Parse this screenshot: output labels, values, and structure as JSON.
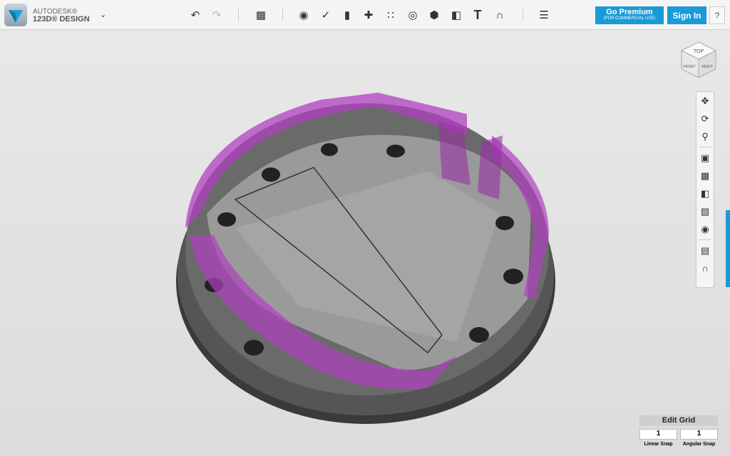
{
  "app": {
    "brand_line1": "AUTODESK®",
    "brand_line2": "123D® DESIGN"
  },
  "toolbar": {
    "undo": "undo-icon",
    "redo": "redo-icon",
    "primitives": "primitives-icon",
    "sketch": "sketch-icon",
    "construct": "construct-icon",
    "modify": "modify-icon",
    "pattern": "pattern-icon",
    "grouping": "grouping-icon",
    "combine": "combine-icon",
    "measure": "measure-icon",
    "text": "T",
    "snap": "snap-icon",
    "materials": "materials-icon"
  },
  "buttons": {
    "premium": "Go Premium",
    "premium_sub": "(FOR COMMERCIAL USE)",
    "signin": "Sign In",
    "help": "?"
  },
  "viewcube": {
    "top": "TOP",
    "front": "FRONT",
    "right": "RIGHT"
  },
  "grid": {
    "title": "Edit Grid",
    "linear_value": "1",
    "angular_value": "1",
    "linear_label": "Linear Snap",
    "angular_label": "Angular Snap"
  },
  "colors": {
    "accent": "#1a9ad6",
    "wall": "#b040c0"
  }
}
